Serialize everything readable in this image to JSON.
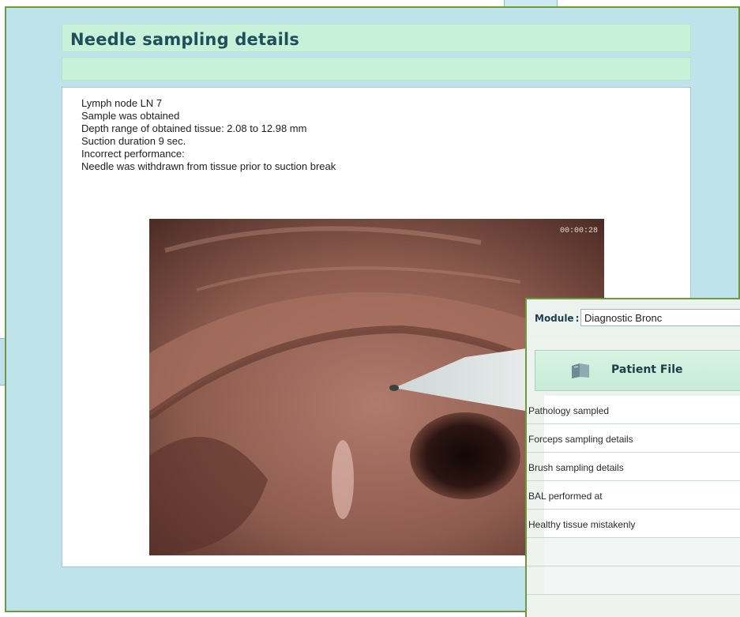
{
  "details": {
    "title": "Needle sampling details",
    "lines": [
      "Lymph node LN 7",
      "Sample was obtained",
      "Depth range of obtained tissue: 2.08 to 12.98 mm",
      "Suction duration 9 sec.",
      "Incorrect performance:",
      "Needle was withdrawn from tissue prior to suction break"
    ],
    "timestamp": "00:00:28"
  },
  "patient_window": {
    "module_label": "Module",
    "module_value": "Diagnostic Bronc",
    "tab_label": "Patient File",
    "tab_icon": "book-icon",
    "rows": [
      "Pathology sampled",
      "Forceps sampling details",
      "Brush sampling details",
      "BAL performed at",
      "Healthy tissue mistakenly",
      "",
      ""
    ]
  },
  "colors": {
    "window_bg": "#bfe3ea",
    "header_bg": "#c8f1d9",
    "window_border": "#6c9a3c",
    "title_text": "#1f4e5c"
  }
}
